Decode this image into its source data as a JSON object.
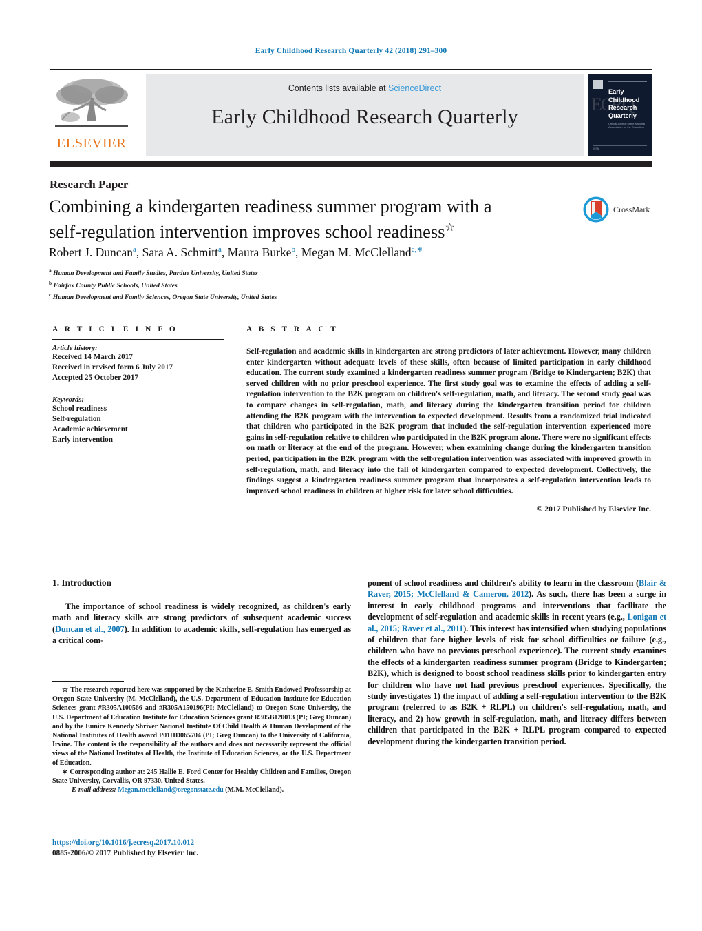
{
  "running_head": "Early Childhood Research Quarterly 42 (2018) 291–300",
  "masthead": {
    "contents_prefix": "Contents lists available at ",
    "sciencedirect": "ScienceDirect",
    "journal_title": "Early Childhood Research Quarterly",
    "publisher_wordmark": "ELSEVIER",
    "cover": {
      "title": "Early Childhood Research Quarterly",
      "monogram": "ECRQ",
      "subtitle": "Official Journal of the\nNational Association for the Education",
      "footer": "ISSN"
    }
  },
  "article": {
    "section_type": "Research Paper",
    "title_line1": "Combining a kindergarten readiness summer program with a",
    "title_line2": "self-regulation intervention improves school readiness",
    "title_footnote_mark": "☆",
    "crossmark_label": "CrossMark",
    "authors": [
      {
        "name": "Robert J. Duncan",
        "sup": "a",
        "sep": ", "
      },
      {
        "name": "Sara A. Schmitt",
        "sup": "a",
        "sep": ", "
      },
      {
        "name": "Maura Burke",
        "sup": "b",
        "sep": ", "
      },
      {
        "name": "Megan M. McClelland",
        "sup": "c,∗",
        "sep": ""
      }
    ],
    "affiliations": [
      {
        "mark": "a",
        "text": "Human Development and Family Studies, Purdue University, United States"
      },
      {
        "mark": "b",
        "text": "Fairfax County Public Schools, United States"
      },
      {
        "mark": "c",
        "text": "Human Development and Family Sciences, Oregon State University, United States"
      }
    ]
  },
  "article_info": {
    "heading": "A R T I C L E  I N F O",
    "history_label": "Article history:",
    "history": [
      "Received 14 March 2017",
      "Received in revised form 6 July 2017",
      "Accepted 25 October 2017"
    ],
    "keywords_label": "Keywords:",
    "keywords": [
      "School readiness",
      "Self-regulation",
      "Academic achievement",
      "Early intervention"
    ]
  },
  "abstract": {
    "heading": "A B S T R A C T",
    "body": "Self-regulation and academic skills in kindergarten are strong predictors of later achievement. However, many children enter kindergarten without adequate levels of these skills, often because of limited participation in early childhood education. The current study examined a kindergarten readiness summer program (Bridge to Kindergarten; B2K) that served children with no prior preschool experience. The first study goal was to examine the effects of adding a self-regulation intervention to the B2K program on children's self-regulation, math, and literacy. The second study goal was to compare changes in self-regulation, math, and literacy during the kindergarten transition period for children attending the B2K program with the intervention to expected development. Results from a randomized trial indicated that children who participated in the B2K program that included the self-regulation intervention experienced more gains in self-regulation relative to children who participated in the B2K program alone. There were no significant effects on math or literacy at the end of the program. However, when examining change during the kindergarten transition period, participation in the B2K program with the self-regulation intervention was associated with improved growth in self-regulation, math, and literacy into the fall of kindergarten compared to expected development. Collectively, the findings suggest a kindergarten readiness summer program that incorporates a self-regulation intervention leads to improved school readiness in children at higher risk for later school difficulties.",
    "copyright": "© 2017 Published by Elsevier Inc."
  },
  "introduction": {
    "heading": "1. Introduction",
    "left_para_1": "The importance of school readiness is widely recognized, as children's early math and literacy skills are strong predictors of subsequent academic success (",
    "left_cite_1": "Duncan et al., 2007",
    "left_para_2": "). In addition to academic skills, self-regulation has emerged as a critical com-",
    "right_para_1": "ponent of school readiness and children's ability to learn in the classroom (",
    "right_cite_1": "Blair & Raver, 2015; McClelland & Cameron, 2012",
    "right_para_2": "). As such, there has been a surge in interest in early childhood programs and interventions that facilitate the development of self-regulation and academic skills in recent years (e.g., ",
    "right_cite_2": "Lonigan et al., 2015; Raver et al., 2011",
    "right_para_3": "). This interest has intensified when studying populations of children that face higher levels of risk for school difficulties or failure (e.g., children who have no previous preschool experience). The current study examines the effects of a kindergarten readiness summer program (Bridge to Kindergarten; B2K), which is designed to boost school readiness skills prior to kindergarten entry for children who have not had previous preschool experiences. Specifically, the study investigates 1) the impact of adding a self-regulation intervention to the B2K program (referred to as B2K + RLPL) on children's self-regulation, math, and literacy, and 2) how growth in self-regulation, math, and literacy differs between children that participated in the B2K + RLPL program compared to expected development during the kindergarten transition period."
  },
  "footnotes": {
    "funding_mark": "☆",
    "funding_text": "The research reported here was supported by the Katherine E. Smith Endowed Professorship at Oregon State University (M. McClelland), the U.S. Department of Education Institute for Education Sciences grant #R305A100566 and #R305A150196(PI; McClelland) to Oregon State University, the U.S. Department of Education Institute for Education Sciences grant R305B120013 (PI; Greg Duncan) and by the Eunice Kennedy Shriver National Institute Of Child Health & Human Development of the National Institutes of Health award P01HD065704 (PI; Greg Duncan) to the University of California, Irvine. The content is the responsibility of the authors and does not necessarily represent the official views of the National Institutes of Health, the Institute of Education Sciences, or the U.S. Department of Education.",
    "corresponding_mark": "∗",
    "corresponding_text": "Corresponding author at: 245 Hallie E. Ford Center for Healthy Children and Families, Oregon State University, Corvallis, OR 97330, United States.",
    "email_label": "E-mail address:",
    "email": "Megan.mcclelland@oregonstate.edu",
    "email_owner": "(M.M. McClelland)."
  },
  "footer": {
    "doi": "https://doi.org/10.1016/j.ecresq.2017.10.012",
    "issn_line": "0885-2006/© 2017 Published by Elsevier Inc."
  },
  "colors": {
    "link": "#1279b5",
    "sciencedirect": "#3a9ad9",
    "elsevier_orange": "#e8761c",
    "banner_gray": "#e7e8e9",
    "dark_bar": "#231f20",
    "cover_navy": "#101a2e"
  }
}
